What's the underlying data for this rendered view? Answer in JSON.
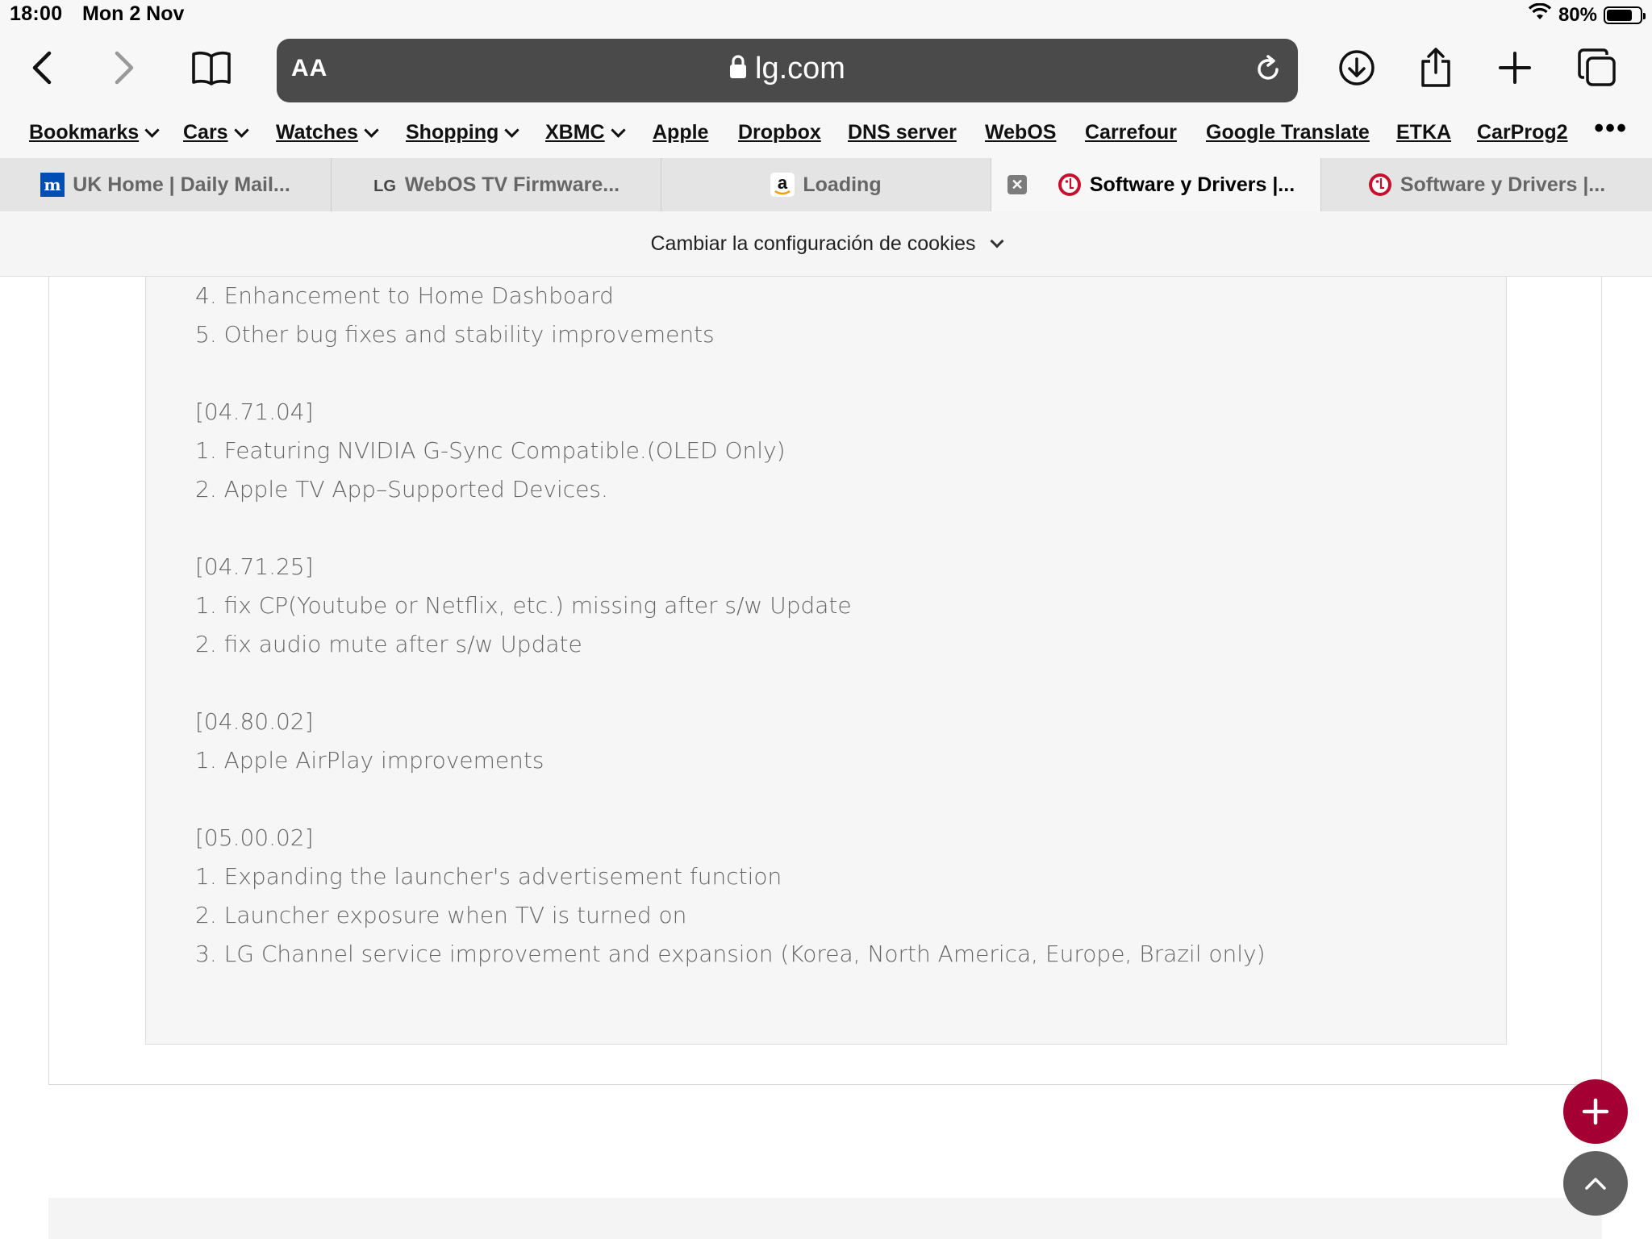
{
  "status_bar": {
    "time": "18:00",
    "date": "Mon 2 Nov",
    "battery": "80%",
    "battery_level": 0.8
  },
  "address_bar": {
    "aa_label": "AA",
    "url": "lg.com"
  },
  "bookmarks": [
    {
      "label": "Bookmarks",
      "folder": true
    },
    {
      "label": "Cars",
      "folder": true
    },
    {
      "label": "Watches",
      "folder": true
    },
    {
      "label": "Shopping",
      "folder": true
    },
    {
      "label": "XBMC",
      "folder": true
    },
    {
      "label": "Apple",
      "folder": false
    },
    {
      "label": "Dropbox",
      "folder": false
    },
    {
      "label": "DNS server",
      "folder": false
    },
    {
      "label": "WebOS",
      "folder": false
    },
    {
      "label": "Carrefour",
      "folder": false
    },
    {
      "label": "Google Translate",
      "folder": false
    },
    {
      "label": "ETKA",
      "folder": false
    },
    {
      "label": "CarProg2",
      "folder": false
    }
  ],
  "tabs": [
    {
      "title": "UK Home | Daily Mail...",
      "icon": "dailymail-icon",
      "active": false
    },
    {
      "title": "WebOS TV Firmware...",
      "icon": "lg-icon",
      "active": false
    },
    {
      "title": "Loading",
      "icon": "amazon-icon",
      "active": false
    },
    {
      "title": "Software y Drivers |...",
      "icon": "lg-logo-icon",
      "active": true
    },
    {
      "title": "Software y Drivers |...",
      "icon": "lg-logo-icon",
      "active": false
    }
  ],
  "cookie_banner": {
    "label": "Cambiar la configuración de cookies"
  },
  "release_notes": [
    {
      "type": "line",
      "text": "4. Enhancement to Home Dashboard"
    },
    {
      "type": "line",
      "text": "5. Other bug fixes and stability improvements"
    },
    {
      "type": "gap",
      "text": ""
    },
    {
      "type": "line",
      "text": "[04.71.04]"
    },
    {
      "type": "line",
      "text": "1. Featuring NVIDIA G-Sync Compatible.(OLED Only)"
    },
    {
      "type": "line",
      "text": "2. Apple TV App–Supported Devices."
    },
    {
      "type": "gap",
      "text": ""
    },
    {
      "type": "line",
      "text": "[04.71.25]"
    },
    {
      "type": "line",
      "text": "1. fix CP(Youtube or Netflix, etc.) missing after s/w Update"
    },
    {
      "type": "line",
      "text": "2. fix audio mute after s/w Update"
    },
    {
      "type": "gap",
      "text": ""
    },
    {
      "type": "line",
      "text": "[04.80.02]"
    },
    {
      "type": "line",
      "text": "1. Apple AirPlay improvements"
    },
    {
      "type": "gap",
      "text": ""
    },
    {
      "type": "line",
      "text": "[05.00.02]"
    },
    {
      "type": "line",
      "text": "1. Expanding the launcher's advertisement function"
    },
    {
      "type": "line",
      "text": "2. Launcher exposure when TV is turned on"
    },
    {
      "type": "line",
      "text": "3. LG Channel service improvement and expansion (Korea, North America, Europe, Brazil only)"
    }
  ],
  "colors": {
    "lg_brand": "#a50034",
    "fab_secondary": "#5f5f5f"
  }
}
